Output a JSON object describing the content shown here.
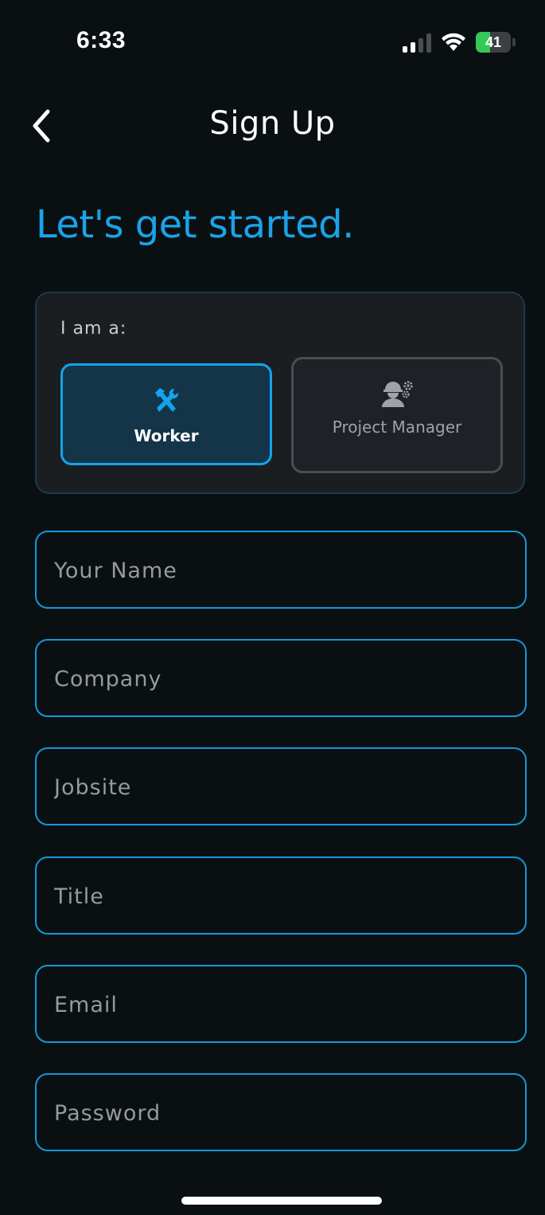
{
  "status_bar": {
    "time": "6:33",
    "battery_level": "41",
    "battery_fraction": 0.41,
    "signal_bars_active": 2,
    "icons": [
      "signal-icon",
      "wifi-icon",
      "battery-icon"
    ]
  },
  "nav": {
    "back_icon": "chevron-left-icon",
    "title": "Sign Up"
  },
  "headline": "Let's get started.",
  "role_selector": {
    "prompt": "I am a:",
    "selected": "worker",
    "options": [
      {
        "id": "worker",
        "label": "Worker",
        "icon": "tools-icon"
      },
      {
        "id": "project_manager",
        "label": "Project Manager",
        "icon": "manager-gear-icon"
      }
    ]
  },
  "form": {
    "fields": [
      {
        "id": "name",
        "placeholder": "Your Name",
        "value": ""
      },
      {
        "id": "company",
        "placeholder": "Company",
        "value": ""
      },
      {
        "id": "jobsite",
        "placeholder": "Jobsite",
        "value": ""
      },
      {
        "id": "title",
        "placeholder": "Title",
        "value": ""
      },
      {
        "id": "email",
        "placeholder": "Email",
        "value": ""
      },
      {
        "id": "password",
        "placeholder": "Password",
        "value": ""
      }
    ]
  },
  "colors": {
    "background": "#0a1012",
    "accent": "#1aa3e8",
    "selected_fill": "#143548",
    "card_fill": "#1a1e21",
    "placeholder": "#969a9e",
    "battery_green": "#34c759"
  }
}
